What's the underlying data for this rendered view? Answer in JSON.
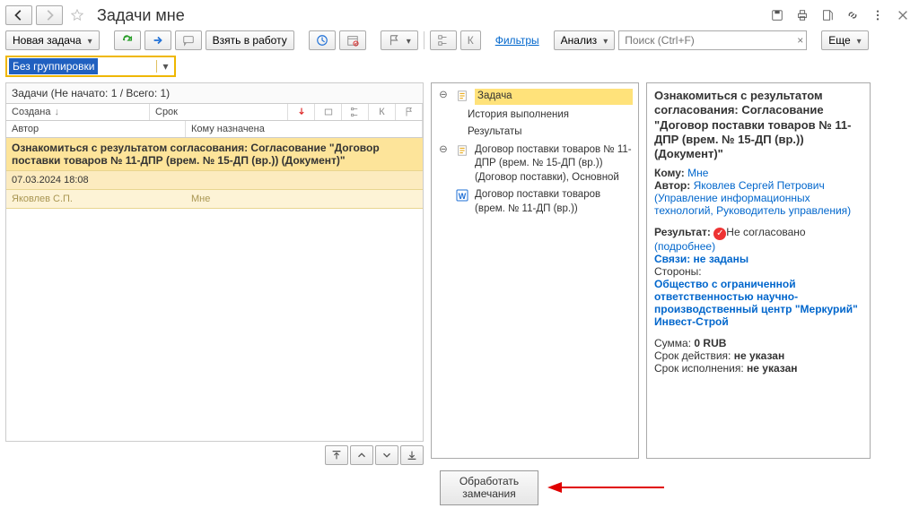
{
  "header": {
    "title": "Задачи мне"
  },
  "toolbar": {
    "new_task": "Новая задача",
    "take_work": "Взять в работу",
    "filters": "Фильтры",
    "analysis": "Анализ",
    "more": "Еще",
    "search_placeholder": "Поиск (Ctrl+F)",
    "k_label": "К"
  },
  "grouping": {
    "value": "Без группировки"
  },
  "tasks": {
    "count_text": "Задачи (Не начато: 1 / Всего: 1)",
    "columns": {
      "created": "Создана",
      "due": "Срок",
      "author": "Автор",
      "assignee": "Кому назначена",
      "k": "К"
    },
    "row": {
      "name": "Ознакомиться с результатом согласования: Согласование \"Договор поставки товаров  № 11-ДПР (врем. № 15-ДП (вр.)) (Документ)\"",
      "date": "07.03.2024 18:08",
      "author": "Яковлев С.П.",
      "assignee": "Мне"
    }
  },
  "mid": {
    "task_label": "Задача",
    "history": "История выполнения",
    "results": "Результаты",
    "doc1": "Договор поставки товаров  № 11-ДПР (врем. № 15-ДП (вр.)) (Договор поставки), Основной",
    "doc2": "Договор поставки товаров (врем. № 11-ДП (вр.))"
  },
  "right": {
    "title": "Ознакомиться с результатом согласования: Согласование \"Договор поставки товаров  № 11-ДПР (врем. № 15-ДП (вр.)) (Документ)\"",
    "to_label": "Кому:",
    "to_value": "Мне",
    "author_label": "Автор:",
    "author_value": "Яковлев Сергей Петрович",
    "author_extra": "(Управление информационных технологий, Руководитель управления)",
    "result_label": "Результат:",
    "result_value": "Не согласовано",
    "result_more": "(подробнее)",
    "links_label": "Связи: не заданы",
    "parties_label": "Стороны:",
    "party1": "Общество с ограниченной ответственностью научно-производственный центр \"Меркурий\"",
    "party2": "Инвест-Строй",
    "sum_label": "Сумма:",
    "sum_value": "0 RUB",
    "validity_label": "Срок действия:",
    "validity_value": "не указан",
    "exec_label": "Срок исполнения:",
    "exec_value": "не указан"
  },
  "footer": {
    "process": "Обработать замечания"
  }
}
